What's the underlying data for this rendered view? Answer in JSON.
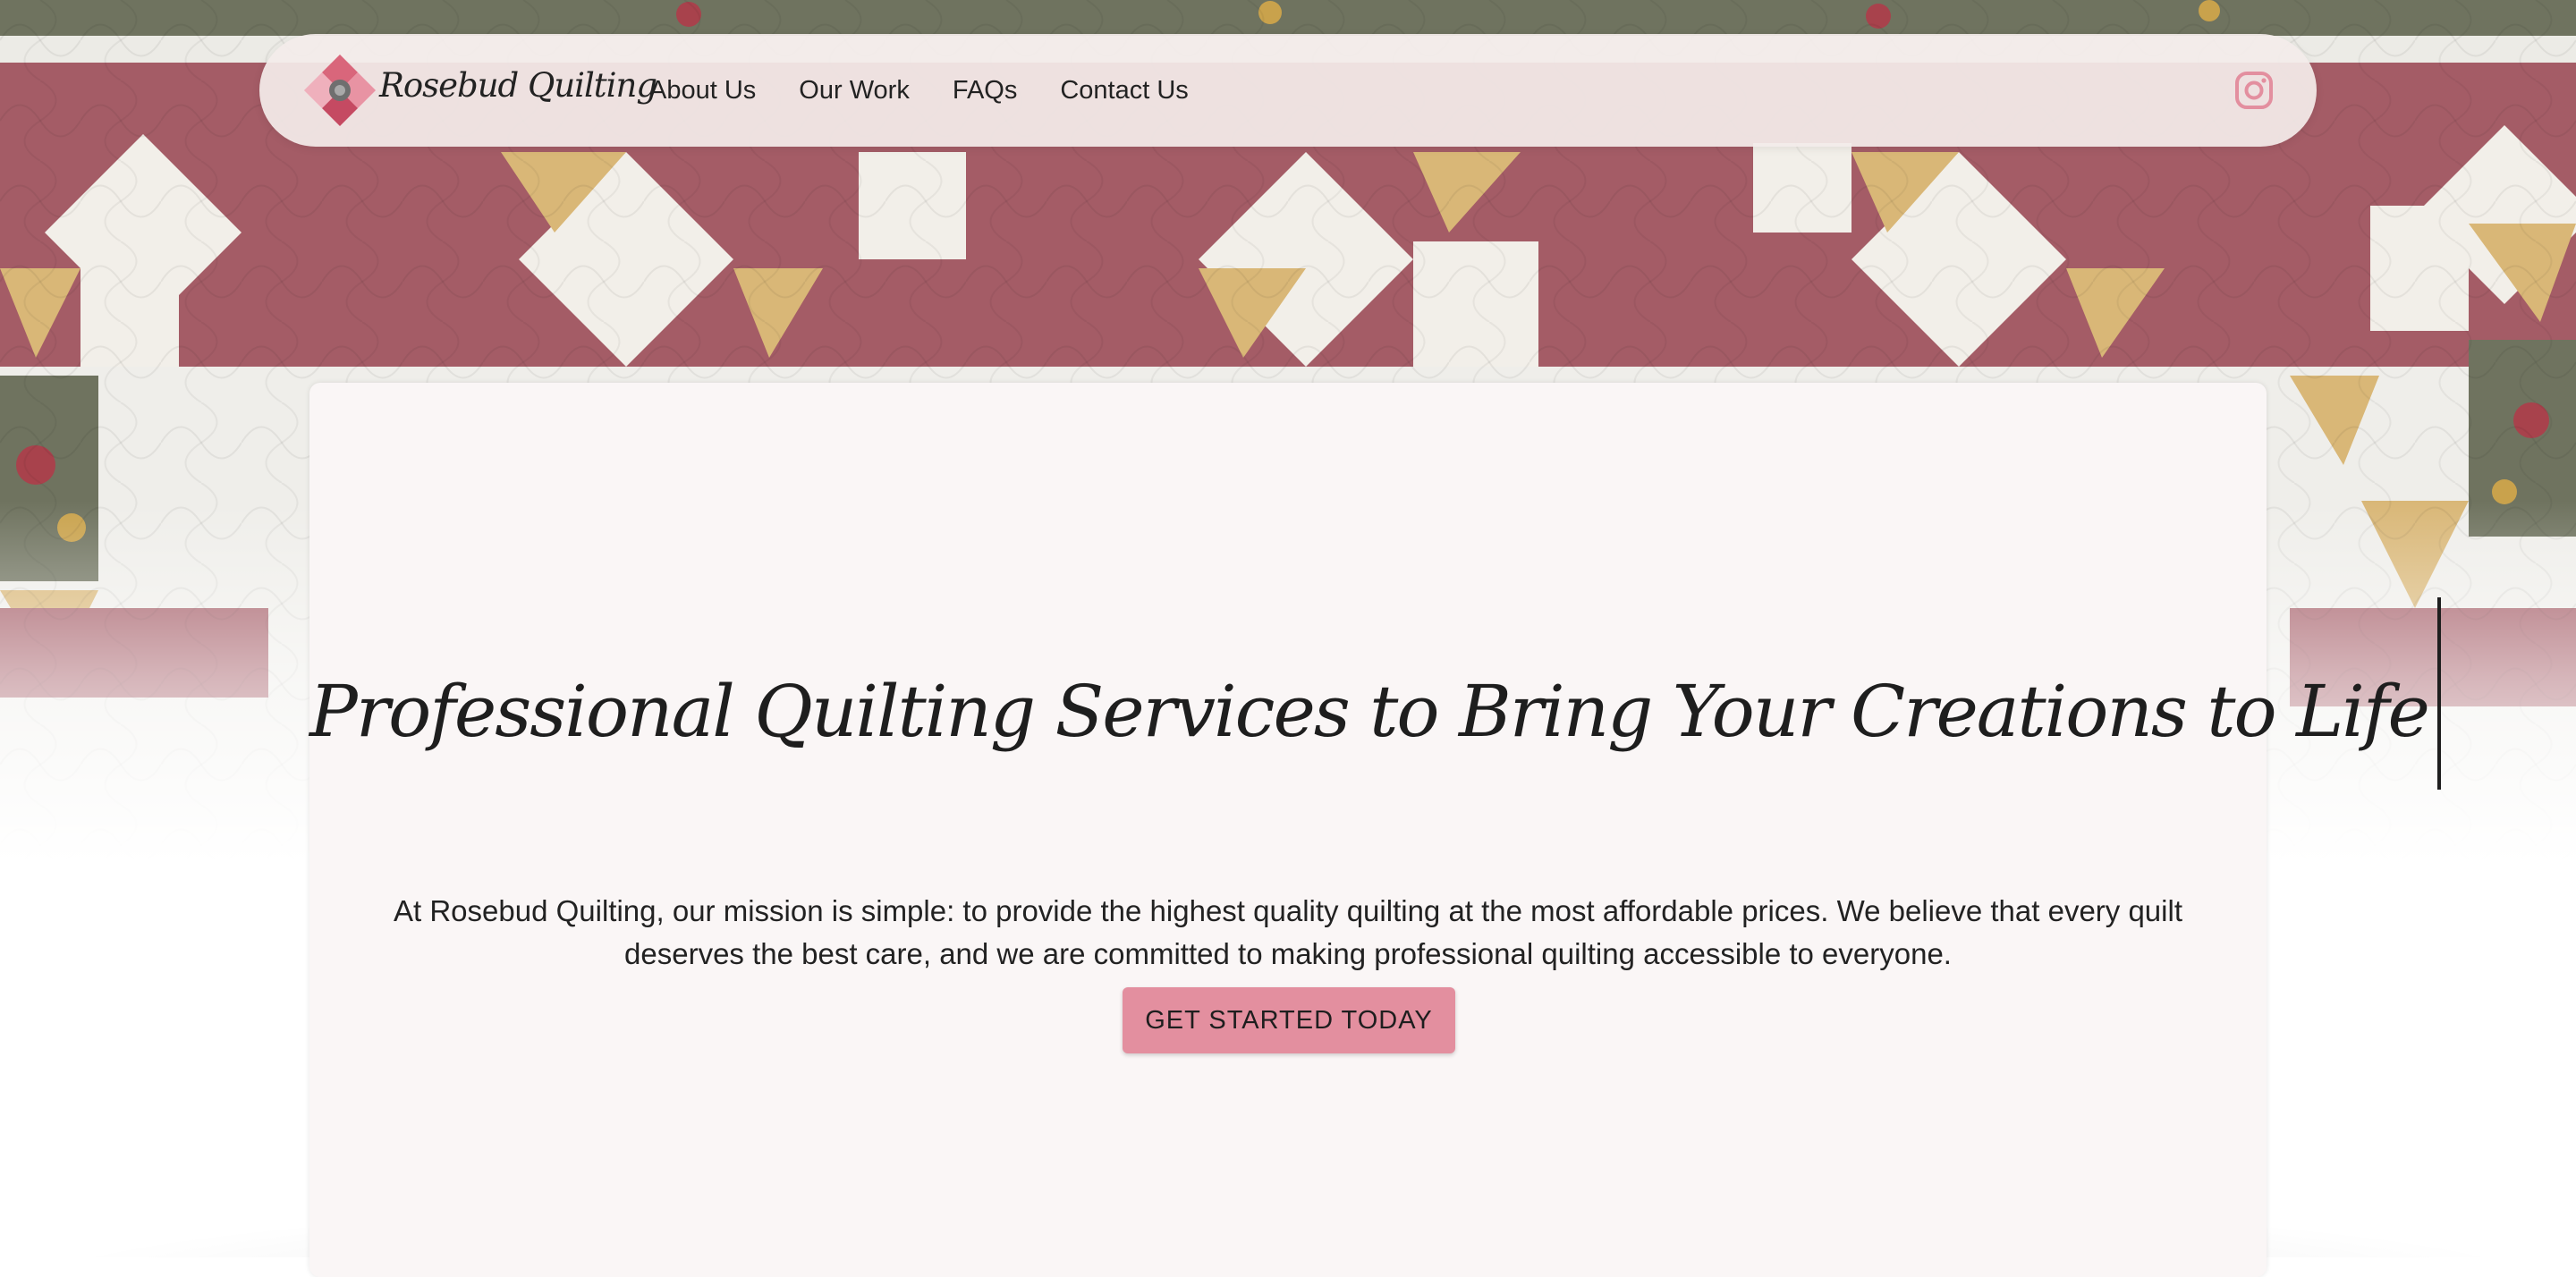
{
  "brand": {
    "name": "Rosebud Quilting",
    "logo_icon": "quilt-block-logo-icon"
  },
  "nav": {
    "links": [
      "About Us",
      "Our Work",
      "FAQs",
      "Contact Us"
    ],
    "instagram_icon": "instagram-icon"
  },
  "hero": {
    "headline": "Professional Quilting Services to Bring Your Creations to Life",
    "description": "At Rosebud Quilting, our mission is simple: to provide the highest quality quilting at the most affordable prices. We believe that every quilt deserves the best care, and we are committed to making professional quilting accessible to everyone.",
    "cta_label": "GET STARTED TODAY"
  },
  "colors": {
    "accent_pink": "#e38f9f",
    "quilt_rose": "#a45c66",
    "quilt_gold": "#d9b777",
    "quilt_cream": "#f2efe9",
    "card_bg": "#faf6f6"
  }
}
